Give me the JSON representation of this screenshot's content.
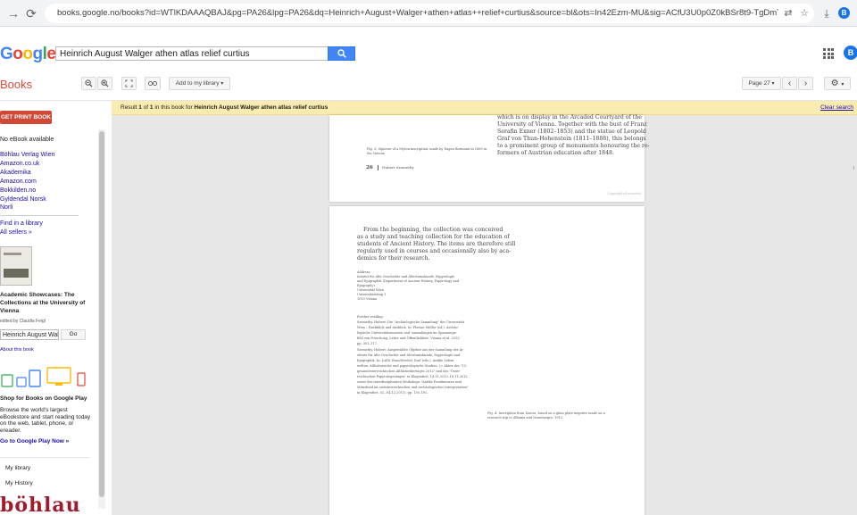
{
  "browser": {
    "url": "books.google.no/books?id=WTlKDAAAQBAJ&pg=PA26&lpg=PA26&dq=Heinrich+August+Walger+athen+atlas++relief+curtius&source=bl&ots=In42Ezm-MU&sig=ACfU3U0p0Z0kBSr8t9-TgDmTZhEVUMMFeQ&hl=en&sa=X&ved=2ahUKEwjPp5u7zPa...",
    "avatar_letter": "B"
  },
  "header": {
    "logo_letters": [
      "G",
      "o",
      "o",
      "g",
      "l",
      "e"
    ],
    "search_value": "Heinrich August Walger athen atlas  relief curtius",
    "account_letter": "B"
  },
  "toolbar": {
    "books_label": "Books",
    "add_library_label": "Add to my library",
    "page_label": "Page 27"
  },
  "result_bar": {
    "text_prefix": "Result ",
    "n1": "1",
    "text_of": " of ",
    "n2": "1",
    "text_mid": " in this book for ",
    "query": "Heinrich August Walger athen atlas relief curtius",
    "clear_label": "Clear search"
  },
  "sidebar": {
    "get_print_label": "GET PRINT BOOK",
    "no_ebook": "No eBook available",
    "sellers": [
      "Böhlau Verlag Wien",
      "Amazon.co.uk",
      "Akademika",
      "Amazon.com",
      "Bokkilden.no",
      "Gyldendal Norsk",
      "Norli"
    ],
    "find_library": "Find in a library",
    "all_sellers": "All sellers »",
    "book_title": "Academic Showcases: The Collections at the University of Vienna",
    "edited_by": "edited by Claudia Feigl",
    "in_book_search": "Heinrich August Walg",
    "go_label": "Go",
    "about_book": "About this book",
    "shop_title": "Shop for Books on Google Play",
    "shop_desc": [
      "Browse the world's largest",
      "eBookstore and start reading today",
      "on the web, tablet, phone, or",
      "ereader."
    ],
    "go_play": "Go to Google Play Now »",
    "my_library": "My library",
    "my_history": "My History",
    "publisher_logo": "böhlau"
  },
  "page26": {
    "right_lines": [
      "which is on display in the Arcaded Courtyard of the",
      "University of Vienna. Together with the bust of Franz",
      "Serafin Exner (1802–1853) and the statue of Leopold",
      "Graf von Thun-Hohenstein (1811–1888), this belongs",
      "to a prominent group of monuments honouring the re-",
      "formers of Austrian education after 1848."
    ],
    "caption": [
      "Fig. 3: Squeeze of a Myron inscription, made by Eugen Bormann in 1889 in",
      "the Vatican"
    ],
    "page_number": "26",
    "author": "Hubert Szemethy",
    "copyright": "Copyrighted material"
  },
  "page27": {
    "body_lines": [
      "From the beginning, the collection was conceived",
      "as a study and teaching collection for the education of",
      "students of Ancient History. The items are therefore still",
      "regularly used in courses and occasionally also by aca-",
      "demics for their research."
    ],
    "address_lines": [
      "Address:",
      "Institut für Alte Geschichte und Altertumskunde, Papyrologie",
      "und Epigraphik (Department of Ancient History, Papyrology and",
      "Epigraphy)",
      "Universität Wien",
      "Universitätsring 1",
      "1010 Vienna"
    ],
    "reading_lines": [
      "Further reading:",
      "Szemethy, Hubert: Die \"Archäologische Sammlung\" des Universität",
      "   Wien – Rückblick und Ausblick. In: Florian Müller (ed.): Archäo-",
      "   logische Universitätsmuseen und -sammlungen im Spannungs-",
      "   feld von Forschung, Lehre und Öffentlichkeit. Vienna et al. 2013,",
      "   pp. 301–317.",
      "Szemethy, Hubert: Ausgewählte Objekte aus der Sammlung des In-",
      "   stituts für Alte Geschichte und Altertumskunde, Papyrologie und",
      "   Epigraphik. In: Loibl, Rosa/Strobel, Karl (eds.): Antike Leben-",
      "   welten. Althistorische und papyrologische Studien. (= Akten des \"13.",
      "   gesamtösterreichischen Althistorikertages 2012\" und des \"Öster-",
      "   reichischen Papyrologentages\" in Klagenfurt, 14.11.2012–18.11.2012",
      "   sowie des interdisziplinären Workshops \"Antike Fundmünzen und",
      "   Münzfund im ostösterreichischen und archäologischer Interpretation\"",
      "   in Klagenfurt, 02.–04.12.2011), pp. 155–192."
    ],
    "caption": [
      "Fig. 4: Inscription from Dascia, based on a glass plate negative made on a",
      "research trip to Albania and Montenegro, 1913"
    ]
  }
}
